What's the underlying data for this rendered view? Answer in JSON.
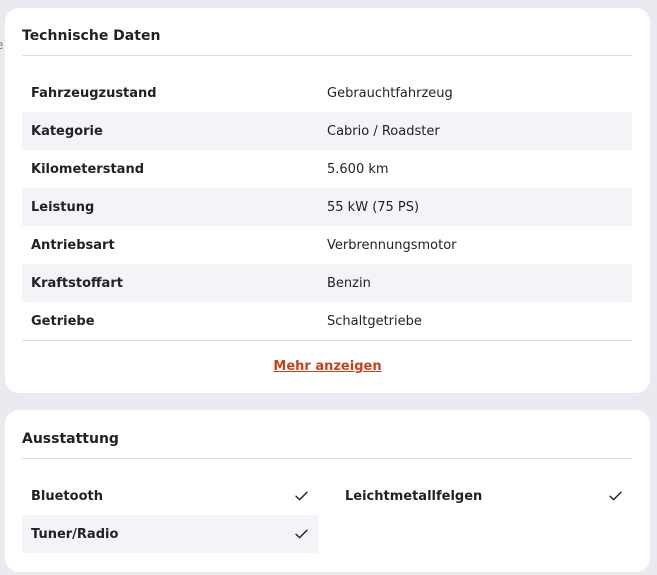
{
  "tech": {
    "title": "Technische Daten",
    "rows": [
      {
        "label": "Fahrzeugzustand",
        "value": "Gebrauchtfahrzeug"
      },
      {
        "label": "Kategorie",
        "value": "Cabrio / Roadster"
      },
      {
        "label": "Kilometerstand",
        "value": "5.600 km"
      },
      {
        "label": "Leistung",
        "value": "55 kW (75 PS)"
      },
      {
        "label": "Antriebsart",
        "value": "Verbrennungsmotor"
      },
      {
        "label": "Kraftstoffart",
        "value": "Benzin"
      },
      {
        "label": "Getriebe",
        "value": "Schaltgetriebe"
      }
    ],
    "more_label": "Mehr anzeigen"
  },
  "equipment": {
    "title": "Ausstattung",
    "items": [
      {
        "label": "Bluetooth",
        "icon": "check-icon"
      },
      {
        "label": "Leichtmetallfelgen",
        "icon": "check-icon"
      },
      {
        "label": "Tuner/Radio",
        "icon": "check-icon"
      }
    ]
  },
  "colors": {
    "link": "#c8411b",
    "shaded_row": "#f3f4f7"
  }
}
